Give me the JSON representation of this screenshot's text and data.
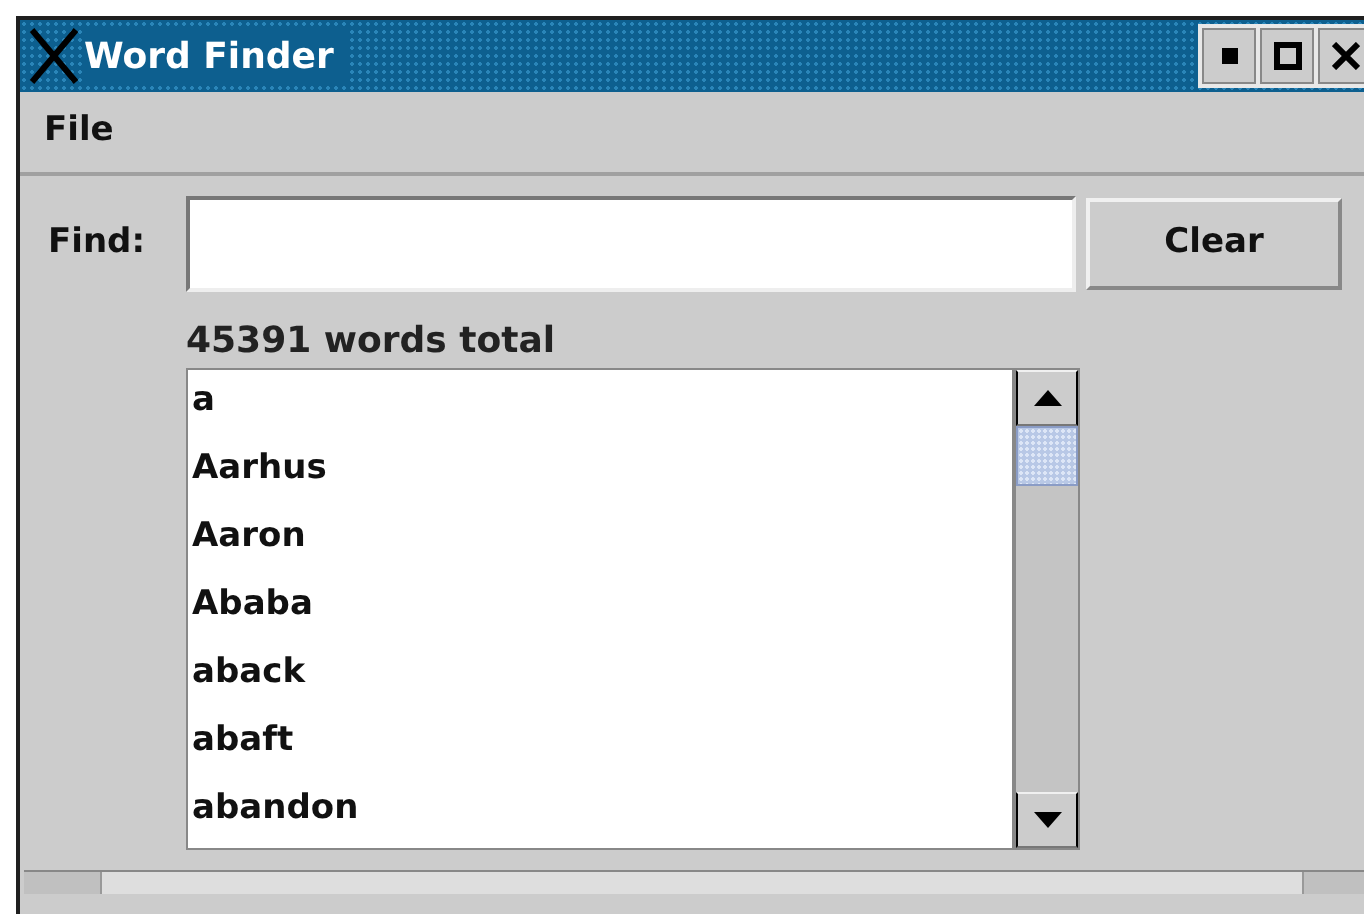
{
  "window": {
    "title": "Word Finder"
  },
  "menu": [
    "File"
  ],
  "find": {
    "label": "Find:",
    "button": "Clear"
  },
  "summary": "45391 words total",
  "words": [
    "a",
    "Aarhus",
    "Aaron",
    "Ababa",
    "aback",
    "abaft",
    "abandon"
  ]
}
